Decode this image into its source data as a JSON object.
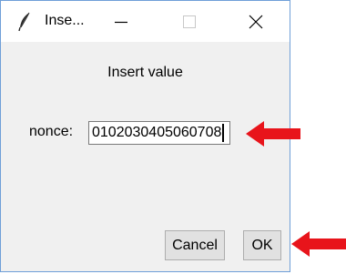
{
  "window": {
    "title": "Inse...",
    "icon": "feather-icon",
    "controls": [
      "minimize-icon",
      "maximize-icon",
      "close-icon"
    ]
  },
  "dialog": {
    "prompt": "Insert value",
    "field_label": "nonce:",
    "field_value": "0102030405060708",
    "cancel_label": "Cancel",
    "ok_label": "OK"
  },
  "annotations": {
    "arrow_color": "#e8141b"
  }
}
